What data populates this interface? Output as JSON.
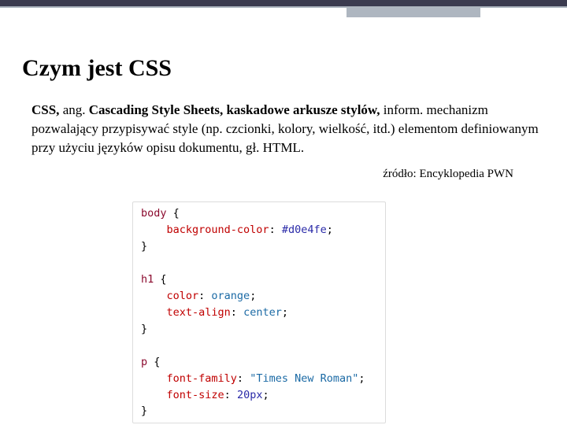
{
  "heading": "Czym jest CSS",
  "def": {
    "b1": "CSS,",
    "t1": " ang. ",
    "b2": "Cascading Style Sheets, kaskadowe arkusze stylów,",
    "t2": " inform. mechanizm pozwalający przypisywać style (np. czcionki, kolory, wielkość, itd.) elementom definiowanym przy użyciu języków opisu dokumentu, gł. HTML."
  },
  "source": "źródło: Encyklopedia PWN",
  "code": {
    "sel1": "body",
    "p1": "background-color",
    "v1": "#d0e4fe",
    "sel2": "h1",
    "p2": "color",
    "v2": "orange",
    "p3": "text-align",
    "v3": "center",
    "sel3": "p",
    "p4": "font-family",
    "v4": "\"Times New Roman\"",
    "p5": "font-size",
    "v5": "20px",
    "ob": " {",
    "cb": "}",
    "colon": ": ",
    "semi": ";"
  }
}
